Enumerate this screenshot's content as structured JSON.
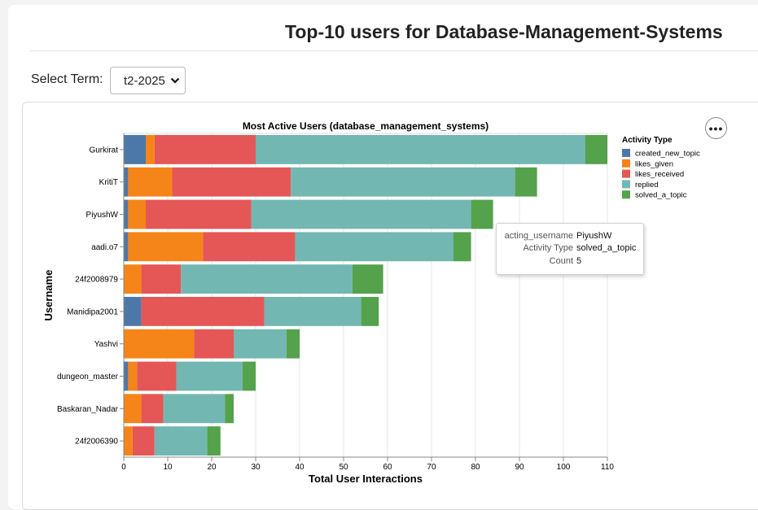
{
  "page": {
    "title": "Top-10 users for Database-Management-Systems",
    "term_label": "Select Term:",
    "term_value": "t2-2025"
  },
  "chart_menu": {
    "icon": "more-horizontal-icon",
    "label": "•••"
  },
  "tooltip": {
    "rows": [
      {
        "key": "acting_username",
        "value": "PiyushW"
      },
      {
        "key": "Activity Type",
        "value": "solved_a_topic"
      },
      {
        "key": "Count",
        "value": "5"
      }
    ]
  },
  "chart_data": {
    "type": "bar",
    "orientation": "horizontal",
    "stacked": true,
    "title": "Most Active Users (database_management_systems)",
    "xlabel": "Total User Interactions",
    "ylabel": "Username",
    "xlim": [
      0,
      110
    ],
    "x_ticks": [
      0,
      10,
      20,
      30,
      40,
      50,
      60,
      70,
      80,
      90,
      100,
      110
    ],
    "grid": true,
    "legend_title": "Activity Type",
    "legend_position": "right",
    "categories": [
      "Gurkirat",
      "KritiT",
      "PiyushW",
      "aadi.o7",
      "24f2008979",
      "Manidipa2001",
      "Yashvi",
      "dungeon_master",
      "Baskaran_Nadar",
      "24f2006390"
    ],
    "series": [
      {
        "name": "created_new_topic",
        "color": "#4c78a8",
        "values": [
          5,
          1,
          1,
          1,
          0,
          4,
          0,
          1,
          0,
          0
        ]
      },
      {
        "name": "likes_given",
        "color": "#f58518",
        "values": [
          2,
          10,
          4,
          17,
          4,
          0,
          16,
          2,
          4,
          2
        ]
      },
      {
        "name": "likes_received",
        "color": "#e45756",
        "values": [
          23,
          27,
          24,
          21,
          9,
          28,
          9,
          9,
          5,
          5
        ]
      },
      {
        "name": "replied",
        "color": "#72b7b2",
        "values": [
          75,
          51,
          50,
          36,
          39,
          22,
          12,
          15,
          14,
          12
        ]
      },
      {
        "name": "solved_a_topic",
        "color": "#54a24b",
        "values": [
          5,
          5,
          5,
          4,
          7,
          4,
          3,
          3,
          2,
          3
        ]
      }
    ]
  }
}
